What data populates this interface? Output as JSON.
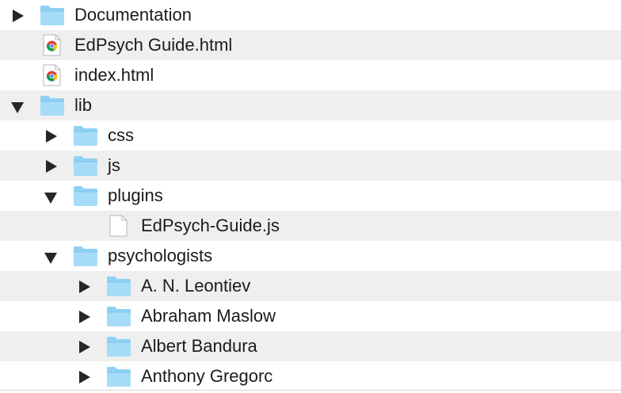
{
  "colors": {
    "row_alt": "#efeff0",
    "folder": "#8fd1f5",
    "text": "#1b1b1b"
  },
  "items": [
    {
      "label": "Documentation",
      "kind": "folder",
      "state": "collapsed",
      "icon": "folder-icon"
    },
    {
      "label": "EdPsych Guide.html",
      "kind": "html-file",
      "icon": "chrome-html-file-icon"
    },
    {
      "label": "index.html",
      "kind": "html-file",
      "icon": "chrome-html-file-icon"
    },
    {
      "label": "lib",
      "kind": "folder",
      "state": "expanded",
      "icon": "folder-icon"
    },
    {
      "label": "css",
      "kind": "folder",
      "state": "collapsed",
      "icon": "folder-icon"
    },
    {
      "label": "js",
      "kind": "folder",
      "state": "collapsed",
      "icon": "folder-icon"
    },
    {
      "label": "plugins",
      "kind": "folder",
      "state": "expanded",
      "icon": "folder-icon"
    },
    {
      "label": "EdPsych-Guide.js",
      "kind": "file",
      "icon": "document-file-icon"
    },
    {
      "label": "psychologists",
      "kind": "folder",
      "state": "expanded",
      "icon": "folder-icon"
    },
    {
      "label": "A. N. Leontiev",
      "kind": "folder",
      "state": "collapsed",
      "icon": "folder-icon"
    },
    {
      "label": "Abraham Maslow",
      "kind": "folder",
      "state": "collapsed",
      "icon": "folder-icon"
    },
    {
      "label": "Albert Bandura",
      "kind": "folder",
      "state": "collapsed",
      "icon": "folder-icon"
    },
    {
      "label": "Anthony Gregorc",
      "kind": "folder",
      "state": "collapsed",
      "icon": "folder-icon"
    }
  ]
}
